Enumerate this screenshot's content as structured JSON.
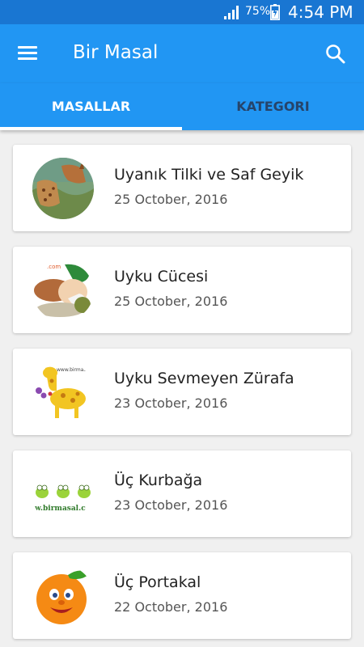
{
  "status_bar": {
    "battery_percent": "75%",
    "time": "4:54 PM",
    "icons": [
      "signal-icon",
      "battery-charging-icon"
    ]
  },
  "app_bar": {
    "title": "Bir Masal",
    "menu_icon": "hamburger-menu-icon",
    "search_icon": "search-icon"
  },
  "tabs": [
    {
      "label": "MASALLAR",
      "selected": true
    },
    {
      "label": "KATEGORI",
      "selected": false
    }
  ],
  "stories": [
    {
      "title": "Uyanık Tilki ve Saf Geyik",
      "date": "25 October, 2016"
    },
    {
      "title": "Uyku Cücesi",
      "date": "25 October, 2016",
      "thumb_text": ".com"
    },
    {
      "title": "Uyku Sevmeyen Zürafa",
      "date": "23 October, 2016",
      "thumb_text": "www.birmasa"
    },
    {
      "title": "Üç Kurbağa",
      "date": "23 October, 2016",
      "thumb_text": "w.birmasal.c"
    },
    {
      "title": "Üç Portakal",
      "date": "22 October, 2016"
    }
  ],
  "colors": {
    "status_bar": "#1976d2",
    "primary": "#2196f3",
    "background": "#f0f0f0",
    "card": "#ffffff"
  }
}
